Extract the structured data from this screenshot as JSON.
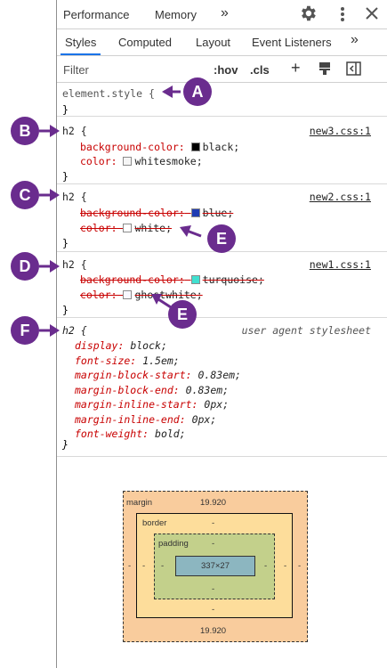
{
  "topbar": {
    "tab1": "Performance",
    "tab2": "Memory",
    "more": "»"
  },
  "tabs": {
    "styles": "Styles",
    "computed": "Computed",
    "layout": "Layout",
    "listeners": "Event Listeners",
    "more": "»"
  },
  "filter": {
    "placeholder": "Filter",
    "hov": ":hov",
    "cls": ".cls",
    "plus": "+"
  },
  "rules": {
    "element": {
      "selector": "element.style",
      "open": "{",
      "close": "}"
    },
    "r1": {
      "selector": "h2",
      "open": "{",
      "close": "}",
      "source": "new3.css:1",
      "p1": {
        "name": "background-color:",
        "value": "black;",
        "swatch": "#000000"
      },
      "p2": {
        "name": "color:",
        "value": "whitesmoke;",
        "swatch": "#f5f5f5"
      }
    },
    "r2": {
      "selector": "h2",
      "open": "{",
      "close": "}",
      "source": "new2.css:1",
      "p1": {
        "name": "background-color:",
        "value": "blue;",
        "swatch": "#1f3bb3"
      },
      "p2": {
        "name": "color:",
        "value": "white;",
        "swatch": "#ffffff"
      }
    },
    "r3": {
      "selector": "h2",
      "open": "{",
      "close": "}",
      "source": "new1.css:1",
      "p1": {
        "name": "background-color:",
        "value": "turquoise;",
        "swatch": "#40e0d0"
      },
      "p2": {
        "name": "color:",
        "value": "ghostwhite;",
        "swatch": "#f8f8ff"
      }
    },
    "ua": {
      "selector": "h2",
      "open": "{",
      "close": "}",
      "source": "user agent stylesheet",
      "props": [
        {
          "name": "display:",
          "value": "block;"
        },
        {
          "name": "font-size:",
          "value": "1.5em;"
        },
        {
          "name": "margin-block-start:",
          "value": "0.83em;"
        },
        {
          "name": "margin-block-end:",
          "value": "0.83em;"
        },
        {
          "name": "margin-inline-start:",
          "value": "0px;"
        },
        {
          "name": "margin-inline-end:",
          "value": "0px;"
        },
        {
          "name": "font-weight:",
          "value": "bold;"
        }
      ]
    }
  },
  "boxmodel": {
    "margin_label": "margin",
    "margin_top": "19.920",
    "margin_bottom": "19.920",
    "margin_left": "-",
    "margin_right": "-",
    "border_label": "border",
    "border_top": "-",
    "border_bottom": "-",
    "border_left": "-",
    "border_right": "-",
    "padding_label": "padding",
    "padding_top": "-",
    "padding_bottom": "-",
    "padding_left": "-",
    "padding_right": "-",
    "content": "337×27"
  },
  "callouts": {
    "a": "A",
    "b": "B",
    "c": "C",
    "d": "D",
    "e1": "E",
    "e2": "E",
    "f": "F"
  },
  "colors": {
    "callout": "#6a2c8e",
    "property": "#c80000",
    "accent": "#1a73e8"
  }
}
